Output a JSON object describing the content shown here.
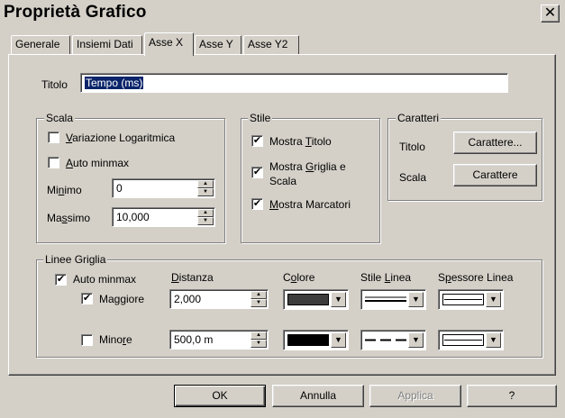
{
  "window": {
    "title": "Proprietà Grafico",
    "close_glyph": "✕"
  },
  "tabs": [
    {
      "label": "Generale"
    },
    {
      "label": "Insiemi Dati"
    },
    {
      "label": "Asse X"
    },
    {
      "label": "Asse Y"
    },
    {
      "label": "Asse Y2"
    }
  ],
  "active_tab": "Asse X",
  "title_field": {
    "label": "Titolo",
    "value": "Tempo (ms)"
  },
  "scala": {
    "group_label": "Scala",
    "log_variation": {
      "label_u": "V",
      "label_rest": "ariazione Logaritmica",
      "checked": false
    },
    "auto_minmax": {
      "label_u": "A",
      "label_rest": "uto minmax",
      "checked": false
    },
    "minimo": {
      "label_pre": "Mi",
      "label_u": "n",
      "label_post": "imo",
      "value": "0"
    },
    "massimo": {
      "label_pre": "Ma",
      "label_u": "s",
      "label_post": "simo",
      "value": "10,000"
    }
  },
  "stile": {
    "group_label": "Stile",
    "mostra_titolo": {
      "label_pre": "Mostra ",
      "label_u": "T",
      "label_post": "itolo",
      "checked": true,
      "check_glyph": "✔"
    },
    "mostra_griglia": {
      "label_pre": "Mostra ",
      "label_u": "G",
      "label_post": "riglia e",
      "label_line2": "Scala",
      "checked": true,
      "check_glyph": "✔"
    },
    "mostra_marcatori": {
      "label_pre": "",
      "label_u": "M",
      "label_post": "ostra Marcatori",
      "checked": true,
      "check_glyph": "✔"
    }
  },
  "caratteri": {
    "group_label": "Caratteri",
    "titolo_label": "Titolo",
    "titolo_button": "Carattere...",
    "scala_label": "Scala",
    "scala_button": "Carattere"
  },
  "linee_griglia": {
    "group_label": "Linee Griglia",
    "auto_minmax": {
      "label": "Auto minmax",
      "checked": true,
      "check_glyph": "✔"
    },
    "headers": {
      "distanza_u": "D",
      "distanza_rest": "istanza",
      "colore_pre": "C",
      "colore_u": "o",
      "colore_post": "lore",
      "stile_pre": "Stile ",
      "stile_u": "L",
      "stile_post": "inea",
      "spessore_pre": "S",
      "spessore_u": "p",
      "spessore_post": "essore Linea"
    },
    "maggiore": {
      "label": "Maggiore",
      "checked": true,
      "check_glyph": "✔",
      "distanza": "2,000",
      "color": "#3c3c3c"
    },
    "minore": {
      "label_pre": "Mino",
      "label_u": "r",
      "label_post": "e",
      "checked": false,
      "distanza": "500,0 m",
      "color": "#000000"
    }
  },
  "buttons": {
    "ok": "OK",
    "annulla": "Annulla",
    "applica": "Applica",
    "help": "?"
  },
  "icons": {
    "dropdown": "▼",
    "spin_up": "▲",
    "spin_down": "▼"
  }
}
